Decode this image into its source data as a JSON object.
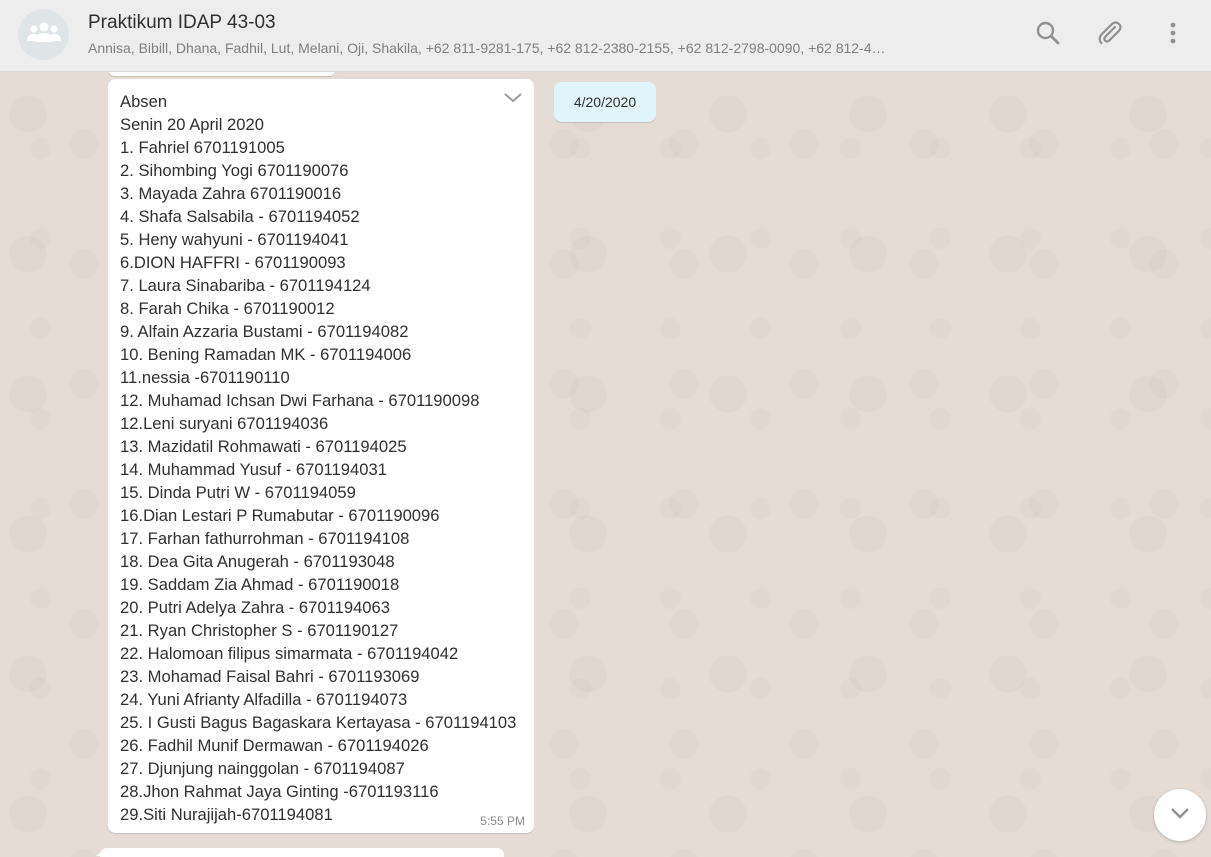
{
  "header": {
    "title": "Praktikum IDAP 43-03",
    "members": "Annisa, Bibill, Dhana, Fadhil, Lut, Melani, Oji, Shakila, +62 811-9281-175, +62 812-2380-2155, +62 812-2798-0090, +62 812-4…",
    "icons": [
      "group-avatar-icon",
      "search-icon",
      "attach-icon",
      "menu-icon"
    ]
  },
  "chat": {
    "date_chip": "4/20/2020",
    "message": {
      "lines": [
        "Absen",
        "Senin 20 April 2020",
        "1. Fahriel 6701191005",
        "2. Sihombing Yogi 6701190076",
        "3. Mayada Zahra 6701190016",
        "4. Shafa Salsabila - 6701194052",
        "5. Heny wahyuni - 6701194041",
        "6.DION HAFFRI - 6701190093",
        "7. Laura Sinabariba - 6701194124",
        "8. Farah Chika - 6701190012",
        "9. Alfain Azzaria Bustami - 6701194082",
        "10. Bening Ramadan MK - 6701194006",
        "11.nessia -6701190110",
        "12. Muhamad Ichsan Dwi Farhana - 6701190098",
        "12.Leni suryani 6701194036",
        "13. Mazidatil Rohmawati - 6701194025",
        "14. Muhammad Yusuf - 6701194031",
        "15. Dinda Putri W - 6701194059",
        "16.Dian Lestari P Rumabutar - 6701190096",
        "17. Farhan fathurrohman - 6701194108",
        "18. Dea Gita Anugerah - 6701193048",
        "19. Saddam Zia Ahmad - 6701190018",
        "20. Putri Adelya Zahra - 6701194063",
        "21. Ryan Christopher S - 6701190127",
        "22. Halomoan filipus simarmata - 6701194042",
        "23. Mohamad Faisal Bahri - 6701193069",
        "24. Yuni Afrianty Alfadilla - 6701194073",
        "25. I Gusti Bagus Bagaskara Kertayasa - 6701194103",
        "26. Fadhil Munif Dermawan - 6701194026",
        "27. Djunjung nainggolan - 6701194087",
        "28.Jhon Rahmat Jaya Ginting -6701193116",
        "29.Siti Nurajijah-6701194081"
      ],
      "time": "5:55 PM",
      "icons": [
        "chevron-down-icon"
      ]
    },
    "scroll_down_icon": "chevron-down-icon"
  },
  "colors": {
    "header_bg": "#ededed",
    "chat_bg": "#e5ddd5",
    "bubble_bg": "#ffffff",
    "date_chip_bg": "#e1f3fb",
    "icon_gray": "#919191"
  }
}
